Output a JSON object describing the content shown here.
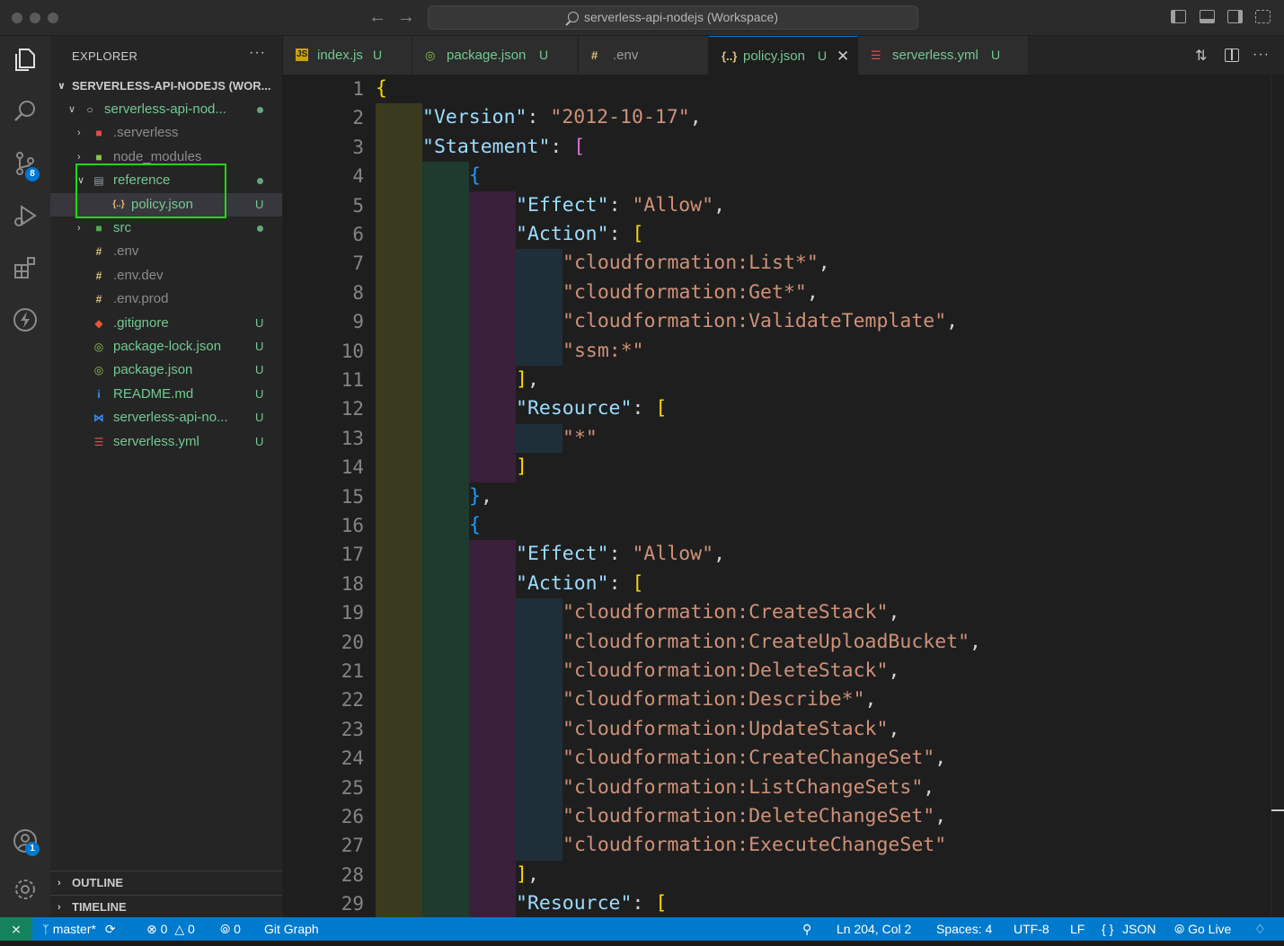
{
  "window": {
    "title": "serverless-api-nodejs (Workspace)"
  },
  "activity_bar": {
    "items": [
      {
        "name": "explorer-icon"
      },
      {
        "name": "search-icon"
      },
      {
        "name": "source-control-icon",
        "badge": "8"
      },
      {
        "name": "run-debug-icon"
      },
      {
        "name": "extensions-icon"
      },
      {
        "name": "lightning-icon"
      }
    ],
    "bottom": [
      {
        "name": "accounts-icon",
        "badge": "1"
      },
      {
        "name": "gear-icon"
      }
    ]
  },
  "sidebar": {
    "title": "EXPLORER",
    "more": "···",
    "workspace": "SERVERLESS-API-NODEJS (WOR...",
    "tree": [
      {
        "label": "serverless-api-nod...",
        "depth": 1,
        "chevron": "open",
        "icon": "root-folder-icon",
        "status": "dot"
      },
      {
        "label": ".serverless",
        "depth": 2,
        "chevron": "closed",
        "icon": "serverless-folder-icon",
        "status": ""
      },
      {
        "label": "node_modules",
        "depth": 2,
        "chevron": "closed",
        "icon": "node-folder-icon",
        "status": ""
      },
      {
        "label": "reference",
        "depth": 2,
        "chevron": "open",
        "icon": "folder-open-icon",
        "status": "dot"
      },
      {
        "label": "policy.json",
        "depth": 3,
        "chevron": "",
        "icon": "json-icon",
        "status": "U",
        "selected": true
      },
      {
        "label": "src",
        "depth": 2,
        "chevron": "closed",
        "icon": "src-folder-icon",
        "status": "dot"
      },
      {
        "label": ".env",
        "depth": 2,
        "chevron": "",
        "icon": "env-icon",
        "status": ""
      },
      {
        "label": ".env.dev",
        "depth": 2,
        "chevron": "",
        "icon": "env-icon",
        "status": ""
      },
      {
        "label": ".env.prod",
        "depth": 2,
        "chevron": "",
        "icon": "env-icon",
        "status": ""
      },
      {
        "label": ".gitignore",
        "depth": 2,
        "chevron": "",
        "icon": "git-icon",
        "status": "U"
      },
      {
        "label": "package-lock.json",
        "depth": 2,
        "chevron": "",
        "icon": "npm-icon",
        "status": "U"
      },
      {
        "label": "package.json",
        "depth": 2,
        "chevron": "",
        "icon": "npm-icon",
        "status": "U"
      },
      {
        "label": "README.md",
        "depth": 2,
        "chevron": "",
        "icon": "info-icon",
        "status": "U"
      },
      {
        "label": "serverless-api-no...",
        "depth": 2,
        "chevron": "",
        "icon": "vscode-icon",
        "status": "U"
      },
      {
        "label": "serverless.yml",
        "depth": 2,
        "chevron": "",
        "icon": "yaml-icon",
        "status": "U"
      }
    ],
    "sections": [
      "OUTLINE",
      "TIMELINE"
    ]
  },
  "tabs": [
    {
      "label": "index.js",
      "status": "U",
      "icon": "js-icon",
      "glyph": "JS"
    },
    {
      "label": "package.json",
      "status": "U",
      "icon": "npm-icon",
      "glyph": "◎"
    },
    {
      "label": ".env",
      "status": "",
      "icon": "env-icon",
      "glyph": "#"
    },
    {
      "label": "policy.json",
      "status": "U",
      "icon": "json-icon",
      "glyph": "{..}",
      "active": true,
      "close": "✕"
    },
    {
      "label": "serverless.yml",
      "status": "U",
      "icon": "yaml-icon",
      "glyph": "☰"
    }
  ],
  "editor": {
    "lines": [
      [
        [
          "b1",
          "{"
        ]
      ],
      [
        [
          "k",
          "\"Version\""
        ],
        [
          "p",
          ": "
        ],
        [
          "s",
          "\"2012-10-17\""
        ],
        [
          "p",
          ","
        ]
      ],
      [
        [
          "k",
          "\"Statement\""
        ],
        [
          "p",
          ": "
        ],
        [
          "b2",
          "["
        ]
      ],
      [
        [
          "b3",
          "{"
        ]
      ],
      [
        [
          "k",
          "\"Effect\""
        ],
        [
          "p",
          ": "
        ],
        [
          "s",
          "\"Allow\""
        ],
        [
          "p",
          ","
        ]
      ],
      [
        [
          "k",
          "\"Action\""
        ],
        [
          "p",
          ": "
        ],
        [
          "b1",
          "["
        ]
      ],
      [
        [
          "s",
          "\"cloudformation:List*\""
        ],
        [
          "p",
          ","
        ]
      ],
      [
        [
          "s",
          "\"cloudformation:Get*\""
        ],
        [
          "p",
          ","
        ]
      ],
      [
        [
          "s",
          "\"cloudformation:ValidateTemplate\""
        ],
        [
          "p",
          ","
        ]
      ],
      [
        [
          "s",
          "\"ssm:*\""
        ]
      ],
      [
        [
          "b1",
          "]"
        ],
        [
          "p",
          ","
        ]
      ],
      [
        [
          "k",
          "\"Resource\""
        ],
        [
          "p",
          ": "
        ],
        [
          "b1",
          "["
        ]
      ],
      [
        [
          "s",
          "\"*\""
        ]
      ],
      [
        [
          "b1",
          "]"
        ]
      ],
      [
        [
          "b3",
          "}"
        ],
        [
          "p",
          ","
        ]
      ],
      [
        [
          "b3",
          "{"
        ]
      ],
      [
        [
          "k",
          "\"Effect\""
        ],
        [
          "p",
          ": "
        ],
        [
          "s",
          "\"Allow\""
        ],
        [
          "p",
          ","
        ]
      ],
      [
        [
          "k",
          "\"Action\""
        ],
        [
          "p",
          ": "
        ],
        [
          "b1",
          "["
        ]
      ],
      [
        [
          "s",
          "\"cloudformation:CreateStack\""
        ],
        [
          "p",
          ","
        ]
      ],
      [
        [
          "s",
          "\"cloudformation:CreateUploadBucket\""
        ],
        [
          "p",
          ","
        ]
      ],
      [
        [
          "s",
          "\"cloudformation:DeleteStack\""
        ],
        [
          "p",
          ","
        ]
      ],
      [
        [
          "s",
          "\"cloudformation:Describe*\""
        ],
        [
          "p",
          ","
        ]
      ],
      [
        [
          "s",
          "\"cloudformation:UpdateStack\""
        ],
        [
          "p",
          ","
        ]
      ],
      [
        [
          "s",
          "\"cloudformation:CreateChangeSet\""
        ],
        [
          "p",
          ","
        ]
      ],
      [
        [
          "s",
          "\"cloudformation:ListChangeSets\""
        ],
        [
          "p",
          ","
        ]
      ],
      [
        [
          "s",
          "\"cloudformation:DeleteChangeSet\""
        ],
        [
          "p",
          ","
        ]
      ],
      [
        [
          "s",
          "\"cloudformation:ExecuteChangeSet\""
        ]
      ],
      [
        [
          "b1",
          "]"
        ],
        [
          "p",
          ","
        ]
      ],
      [
        [
          "k",
          "\"Resource\""
        ],
        [
          "p",
          ": "
        ],
        [
          "b1",
          "["
        ]
      ]
    ],
    "indents": [
      0,
      1,
      1,
      2,
      3,
      3,
      4,
      4,
      4,
      4,
      3,
      3,
      4,
      3,
      2,
      2,
      3,
      3,
      4,
      4,
      4,
      4,
      4,
      4,
      4,
      4,
      4,
      3,
      3
    ]
  },
  "statusbar": {
    "remote": "⨯",
    "branch": "master*",
    "sync": "⟳",
    "errors": "0",
    "warnings": "0",
    "ports": "0",
    "git_graph": "Git Graph",
    "zoom_icon": "zoom-icon",
    "position": "Ln 204, Col 2",
    "spaces": "Spaces: 4",
    "encoding": "UTF-8",
    "eol": "LF",
    "language_braces": "{ }",
    "language": "JSON",
    "go_live": "Go Live",
    "bell": "bell-icon"
  },
  "colors": {
    "accent": "#007acc",
    "untracked": "#73c991",
    "highlight_box": "#25d414"
  }
}
